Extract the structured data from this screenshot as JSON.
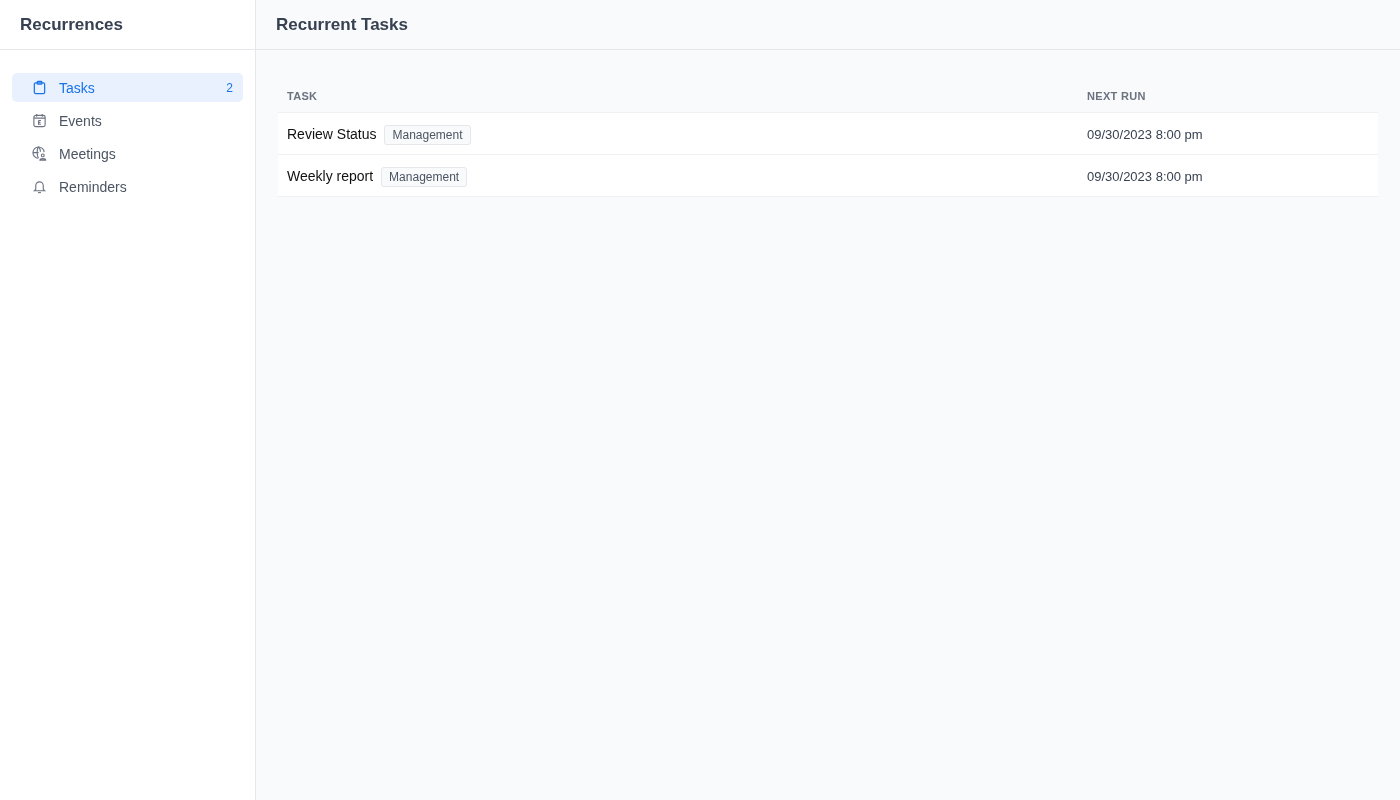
{
  "sidebar": {
    "title": "Recurrences",
    "items": [
      {
        "label": "Tasks",
        "count": "2",
        "selected": true
      },
      {
        "label": "Events",
        "selected": false
      },
      {
        "label": "Meetings",
        "selected": false
      },
      {
        "label": "Reminders",
        "selected": false
      }
    ]
  },
  "main": {
    "title": "Recurrent Tasks"
  },
  "table": {
    "columns": [
      "TASK",
      "NEXT RUN"
    ],
    "rows": [
      {
        "task": "Review Status",
        "tag": "Management",
        "next_run": "09/30/2023 8:00 pm"
      },
      {
        "task": "Weekly report",
        "tag": "Management",
        "next_run": "09/30/2023 8:00 pm"
      }
    ]
  }
}
